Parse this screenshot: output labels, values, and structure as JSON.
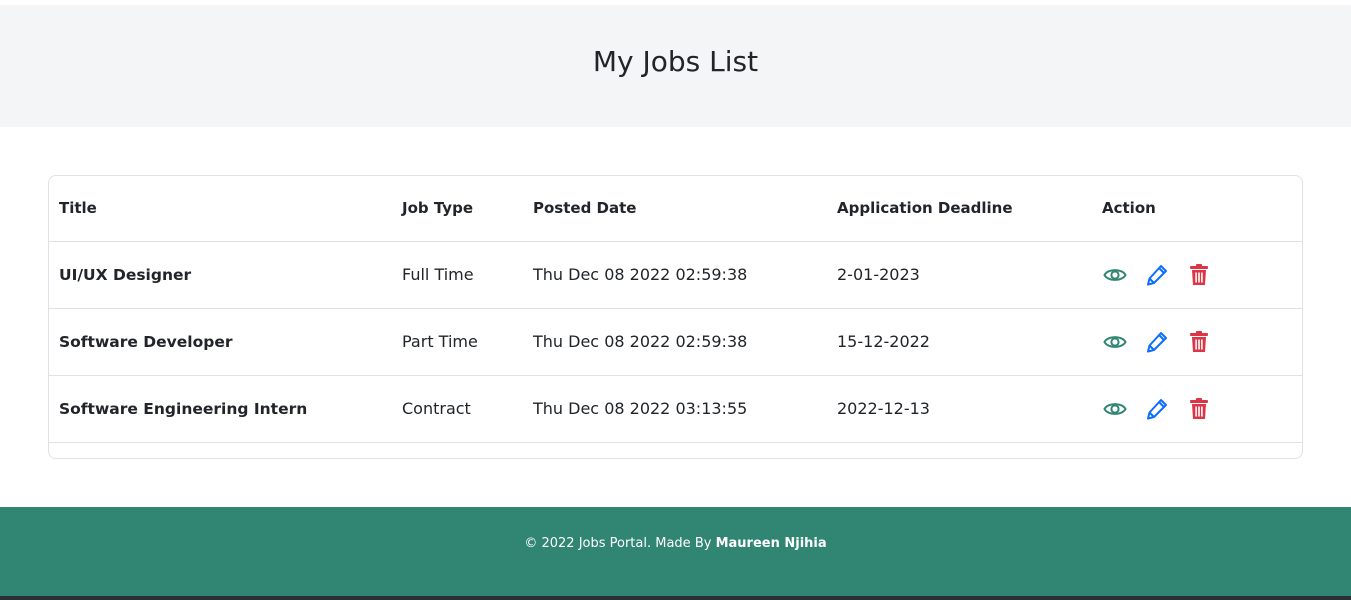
{
  "header": {
    "title": "My Jobs List"
  },
  "table": {
    "columns": [
      "Title",
      "Job Type",
      "Posted Date",
      "Application Deadline",
      "Action"
    ],
    "rows": [
      {
        "title": "UI/UX Designer",
        "job_type": "Full Time",
        "posted_date": "Thu Dec 08 2022 02:59:38",
        "deadline": "2-01-2023"
      },
      {
        "title": "Software Developer",
        "job_type": "Part Time",
        "posted_date": "Thu Dec 08 2022 02:59:38",
        "deadline": "15-12-2022"
      },
      {
        "title": "Software Engineering Intern",
        "job_type": "Contract",
        "posted_date": "Thu Dec 08 2022 03:13:55",
        "deadline": "2022-12-13"
      }
    ],
    "action_icons": [
      "eye-icon",
      "pencil-icon",
      "trash-icon"
    ]
  },
  "footer": {
    "text": "© 2022 Jobs Portal. Made By",
    "author": "Maureen Njihia"
  },
  "colors": {
    "header_bg": "#f4f5f7",
    "footer_bg": "#318573",
    "view": "#318573",
    "edit": "#0d6efd",
    "delete": "#dc3545"
  }
}
